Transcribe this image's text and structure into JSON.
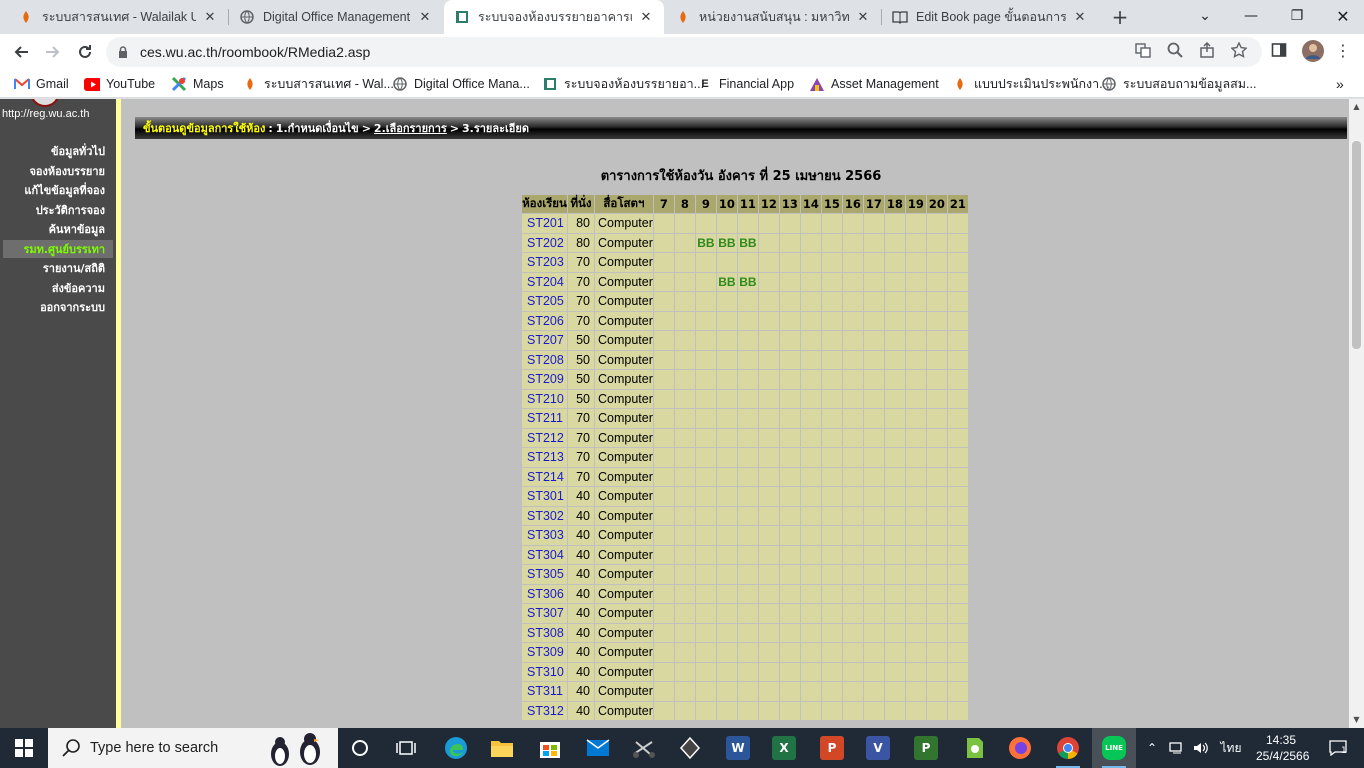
{
  "browser": {
    "tabs": [
      {
        "title": "ระบบสารสนเทศ - Walailak Univ",
        "active": false
      },
      {
        "title": "Digital Office Management S",
        "active": false
      },
      {
        "title": "ระบบจองห้องบรรยายอาคารเรียนรว",
        "active": true
      },
      {
        "title": "หน่วยงานสนับสนุน : มหาวิทยาลัย",
        "active": false
      },
      {
        "title": "Edit Book page ขั้นตอนการปฏิ",
        "active": false
      }
    ],
    "url": "ces.wu.ac.th/roombook/RMedia2.asp",
    "bookmarks": [
      {
        "label": "Gmail",
        "icon": "gmail-icon"
      },
      {
        "label": "YouTube",
        "icon": "youtube-icon"
      },
      {
        "label": "Maps",
        "icon": "maps-icon"
      },
      {
        "label": "ระบบสารสนเทศ - Wal...",
        "icon": "walailak-icon"
      },
      {
        "label": "Digital Office Mana...",
        "icon": "globe-icon"
      },
      {
        "label": "ระบบจองห้องบรรยายอา...",
        "icon": "roombook-icon"
      },
      {
        "label": "Financial App",
        "icon": "letter-e-icon"
      },
      {
        "label": "Asset Management",
        "icon": "asset-icon"
      },
      {
        "label": "แบบประเมินประพนักงา...",
        "icon": "walailak-icon"
      },
      {
        "label": "ระบบสอบถามข้อมูลสม...",
        "icon": "globe-icon"
      }
    ]
  },
  "sidebar": {
    "site_url": "http://reg.wu.ac.th",
    "items": [
      {
        "label": "ข้อมูลทั่วไป",
        "active": false
      },
      {
        "label": "จองห้องบรรยาย",
        "active": false
      },
      {
        "label": "แก้ไขข้อมูลที่จอง",
        "active": false
      },
      {
        "label": "ประวัติการจอง",
        "active": false
      },
      {
        "label": "ค้นหาข้อมูล",
        "active": false
      },
      {
        "label": "รมท.ศูนย์บรรเทา",
        "active": true
      },
      {
        "label": "รายงาน/สถิติ",
        "active": false
      },
      {
        "label": "ส่งข้อความ",
        "active": false
      },
      {
        "label": "ออกจากระบบ",
        "active": false
      }
    ]
  },
  "steps": {
    "label": "ขั้นตอนดูข้อมูลการใช้ห้อง",
    "sep": ":",
    "step1": "1.กำหนดเงื่อนไข",
    "arrow": ">",
    "step2": "2.เลือกรายการ",
    "step3": "3.รายละเอียด"
  },
  "schedule": {
    "title": "ตารางการใช้ห้องวัน อังคาร ที่ 25 เมษายน 2566",
    "headers": {
      "room": "ห้องเรียน",
      "seats": "ที่นั่ง",
      "media": "สื่อโสตฯ"
    },
    "hours": [
      "7",
      "8",
      "9",
      "10",
      "11",
      "12",
      "13",
      "14",
      "15",
      "16",
      "17",
      "18",
      "19",
      "20",
      "21"
    ],
    "rows": [
      {
        "room": "ST201",
        "seats": "80",
        "media": "Computer",
        "bookings": {}
      },
      {
        "room": "ST202",
        "seats": "80",
        "media": "Computer",
        "bookings": {
          "9": "BB",
          "10": "BB",
          "11": "BB"
        }
      },
      {
        "room": "ST203",
        "seats": "70",
        "media": "Computer",
        "bookings": {}
      },
      {
        "room": "ST204",
        "seats": "70",
        "media": "Computer",
        "bookings": {
          "10": "BB",
          "11": "BB"
        }
      },
      {
        "room": "ST205",
        "seats": "70",
        "media": "Computer",
        "bookings": {}
      },
      {
        "room": "ST206",
        "seats": "70",
        "media": "Computer",
        "bookings": {}
      },
      {
        "room": "ST207",
        "seats": "50",
        "media": "Computer",
        "bookings": {}
      },
      {
        "room": "ST208",
        "seats": "50",
        "media": "Computer",
        "bookings": {}
      },
      {
        "room": "ST209",
        "seats": "50",
        "media": "Computer",
        "bookings": {}
      },
      {
        "room": "ST210",
        "seats": "50",
        "media": "Computer",
        "bookings": {}
      },
      {
        "room": "ST211",
        "seats": "70",
        "media": "Computer",
        "bookings": {}
      },
      {
        "room": "ST212",
        "seats": "70",
        "media": "Computer",
        "bookings": {}
      },
      {
        "room": "ST213",
        "seats": "70",
        "media": "Computer",
        "bookings": {}
      },
      {
        "room": "ST214",
        "seats": "70",
        "media": "Computer",
        "bookings": {}
      },
      {
        "room": "ST301",
        "seats": "40",
        "media": "Computer",
        "bookings": {}
      },
      {
        "room": "ST302",
        "seats": "40",
        "media": "Computer",
        "bookings": {}
      },
      {
        "room": "ST303",
        "seats": "40",
        "media": "Computer",
        "bookings": {}
      },
      {
        "room": "ST304",
        "seats": "40",
        "media": "Computer",
        "bookings": {}
      },
      {
        "room": "ST305",
        "seats": "40",
        "media": "Computer",
        "bookings": {}
      },
      {
        "room": "ST306",
        "seats": "40",
        "media": "Computer",
        "bookings": {}
      },
      {
        "room": "ST307",
        "seats": "40",
        "media": "Computer",
        "bookings": {}
      },
      {
        "room": "ST308",
        "seats": "40",
        "media": "Computer",
        "bookings": {}
      },
      {
        "room": "ST309",
        "seats": "40",
        "media": "Computer",
        "bookings": {}
      },
      {
        "room": "ST310",
        "seats": "40",
        "media": "Computer",
        "bookings": {}
      },
      {
        "room": "ST311",
        "seats": "40",
        "media": "Computer",
        "bookings": {}
      },
      {
        "room": "ST312",
        "seats": "40",
        "media": "Computer",
        "bookings": {}
      }
    ]
  },
  "taskbar": {
    "search_placeholder": "Type here to search",
    "apps": [
      {
        "name": "cortana-icon"
      },
      {
        "name": "task-view-icon"
      },
      {
        "name": "edge-icon"
      },
      {
        "name": "file-explorer-icon"
      },
      {
        "name": "store-icon"
      },
      {
        "name": "mail-icon"
      },
      {
        "name": "snip-icon"
      },
      {
        "name": "vpn-icon"
      },
      {
        "name": "word-icon",
        "letter": "W"
      },
      {
        "name": "excel-icon",
        "letter": "X"
      },
      {
        "name": "powerpoint-icon",
        "letter": "P"
      },
      {
        "name": "visio-icon",
        "letter": "V"
      },
      {
        "name": "project-icon",
        "letter": "P"
      },
      {
        "name": "evernote-icon"
      },
      {
        "name": "firefox-icon"
      },
      {
        "name": "chrome-icon"
      },
      {
        "name": "line-icon",
        "letter": "LINE"
      }
    ],
    "language": "ไทย",
    "time": "14:35",
    "date": "25/4/2566",
    "notifications": "1"
  },
  "colors": {
    "page_bg": "#c0c0c0",
    "sidebar_bg": "#4a4a4a",
    "active_nav": "#7cfc00",
    "header_cell": "#aaa86c",
    "body_cell": "#d8d8a0",
    "room_link": "#1a1acd",
    "booking": "#2e8b1a"
  }
}
